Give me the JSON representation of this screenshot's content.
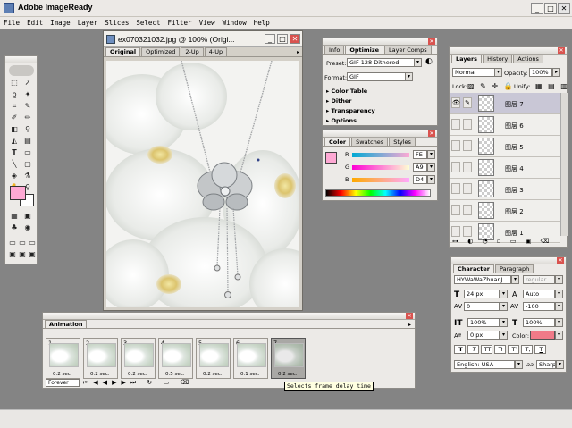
{
  "app": {
    "title": "Adobe ImageReady"
  },
  "menu": [
    "File",
    "Edit",
    "Image",
    "Layer",
    "Slices",
    "Select",
    "Filter",
    "View",
    "Window",
    "Help"
  ],
  "window_buttons": {
    "minimize": "_",
    "maximize": "□",
    "close": "✕"
  },
  "image_window": {
    "title": "ex070321032.jpg @ 100% (Origi...",
    "tabs": [
      "Original",
      "Optimized",
      "2-Up",
      "4-Up"
    ],
    "active_tab": "Original"
  },
  "optimize_panel": {
    "tabs": [
      "Info",
      "Optimize",
      "Layer Comps"
    ],
    "active_tab": "Optimize",
    "preset_label": "Preset:",
    "preset_value": "GIF 128 Dithered",
    "format_label": "Format:",
    "format_value": "GIF",
    "sections": [
      "Color Table",
      "Dither",
      "Transparency",
      "Options"
    ]
  },
  "color_panel": {
    "tabs": [
      "Color",
      "Swatches",
      "Styles"
    ],
    "active_tab": "Color",
    "channels": [
      {
        "label": "R",
        "value": "FE"
      },
      {
        "label": "G",
        "value": "A9"
      },
      {
        "label": "B",
        "value": "D4"
      }
    ],
    "foreground_color": "#fea9d4"
  },
  "layers_panel": {
    "tabs": [
      "Layers",
      "History",
      "Actions"
    ],
    "active_tab": "Layers",
    "blend_mode": "Normal",
    "opacity_label": "Opacity:",
    "opacity_value": "100%",
    "lock_label": "Lock:",
    "unify_label": "Unify:",
    "layers": [
      "图层 7",
      "图层 6",
      "图层 5",
      "图层 4",
      "图层 3",
      "图层 2",
      "图层 1"
    ],
    "selected_layer": "图层 7"
  },
  "character_panel": {
    "tabs": [
      "Character",
      "Paragraph"
    ],
    "active_tab": "Character",
    "font_family": "HYWaWaZhuanJ",
    "font_style": "regular",
    "font_size": "24 px",
    "leading": "Auto",
    "kerning": "0",
    "tracking": "-100",
    "vertical_scale": "100%",
    "horizontal_scale": "100%",
    "baseline_shift": "0 px",
    "color_label": "Color:",
    "color_value": "#f07a88",
    "style_buttons": [
      "T",
      "T",
      "TT",
      "Tr",
      "T'",
      "T,",
      "T"
    ],
    "language": "English: USA",
    "aa_label": "aa",
    "antialias": "Sharp"
  },
  "animation_panel": {
    "tab": "Animation",
    "frames": [
      {
        "num": "1",
        "delay": "0.2 sec."
      },
      {
        "num": "2",
        "delay": "0.2 sec."
      },
      {
        "num": "3",
        "delay": "0.2 sec."
      },
      {
        "num": "4",
        "delay": "0.5 sec."
      },
      {
        "num": "5",
        "delay": "0.2 sec."
      },
      {
        "num": "6",
        "delay": "0.1 sec."
      },
      {
        "num": "7",
        "delay": "0.2 sec."
      }
    ],
    "selected_frame": "7",
    "loop": "Forever",
    "tooltip": "Selects frame delay time"
  },
  "toolbox": {
    "foreground": "#fea9d4",
    "background": "#ffffff"
  }
}
